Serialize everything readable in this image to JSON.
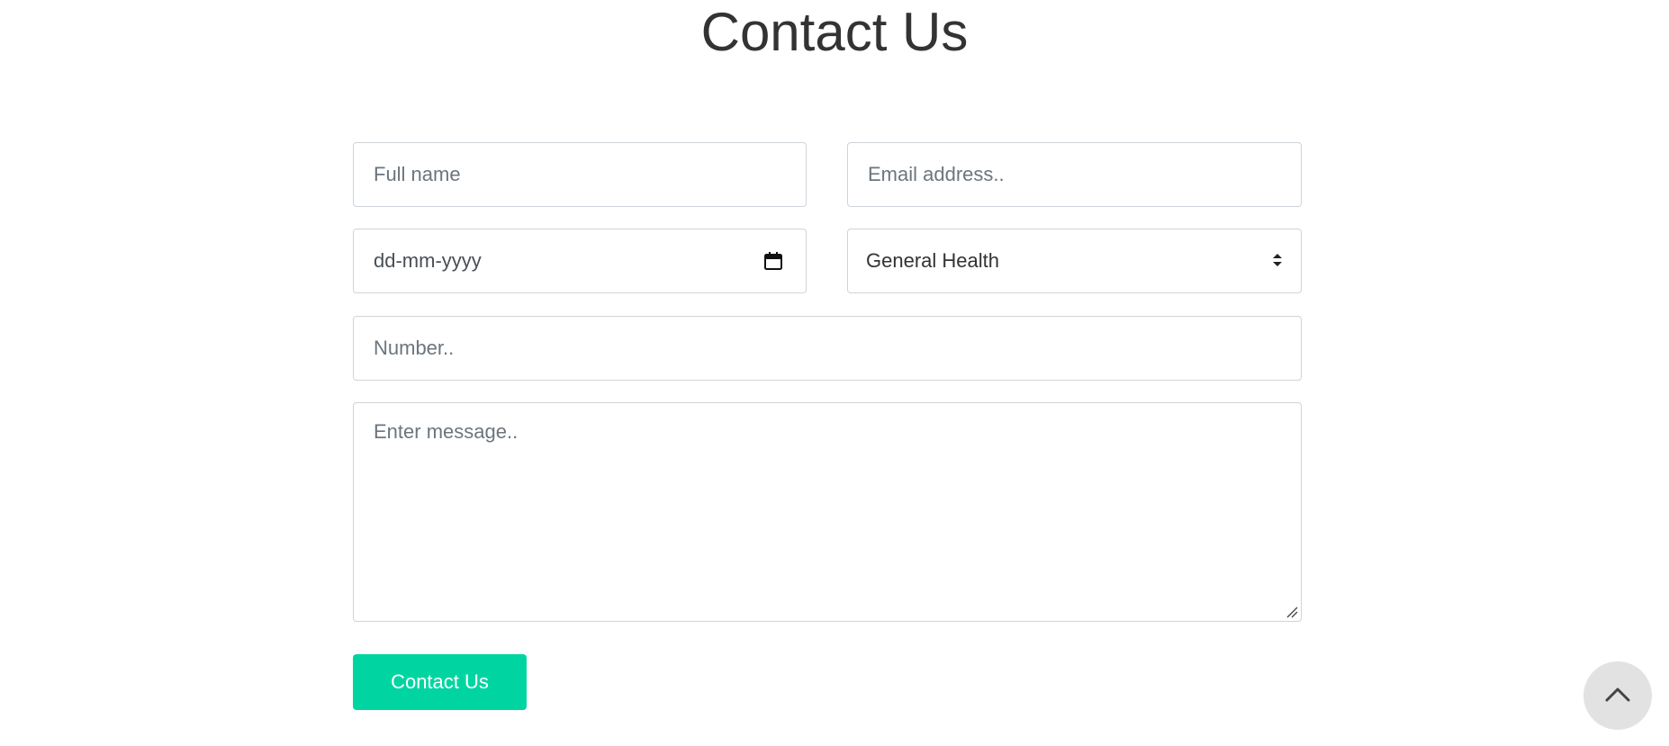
{
  "title": "Contact Us",
  "form": {
    "full_name_placeholder": "Full name",
    "email_placeholder": "Email address..",
    "date_placeholder": "dd-mm-yyyy",
    "department_selected": "General Health",
    "number_placeholder": "Number..",
    "message_placeholder": "Enter message..",
    "submit_label": "Contact Us"
  },
  "icons": {
    "calendar": "calendar-icon",
    "select_arrows": "sort-arrows-icon",
    "resize": "resize-grip-icon",
    "scroll_top": "chevron-up-icon"
  },
  "colors": {
    "accent": "#00d5a1",
    "title": "#333333",
    "border": "#ced4da",
    "scroll_top_bg": "#e2e2e2"
  }
}
